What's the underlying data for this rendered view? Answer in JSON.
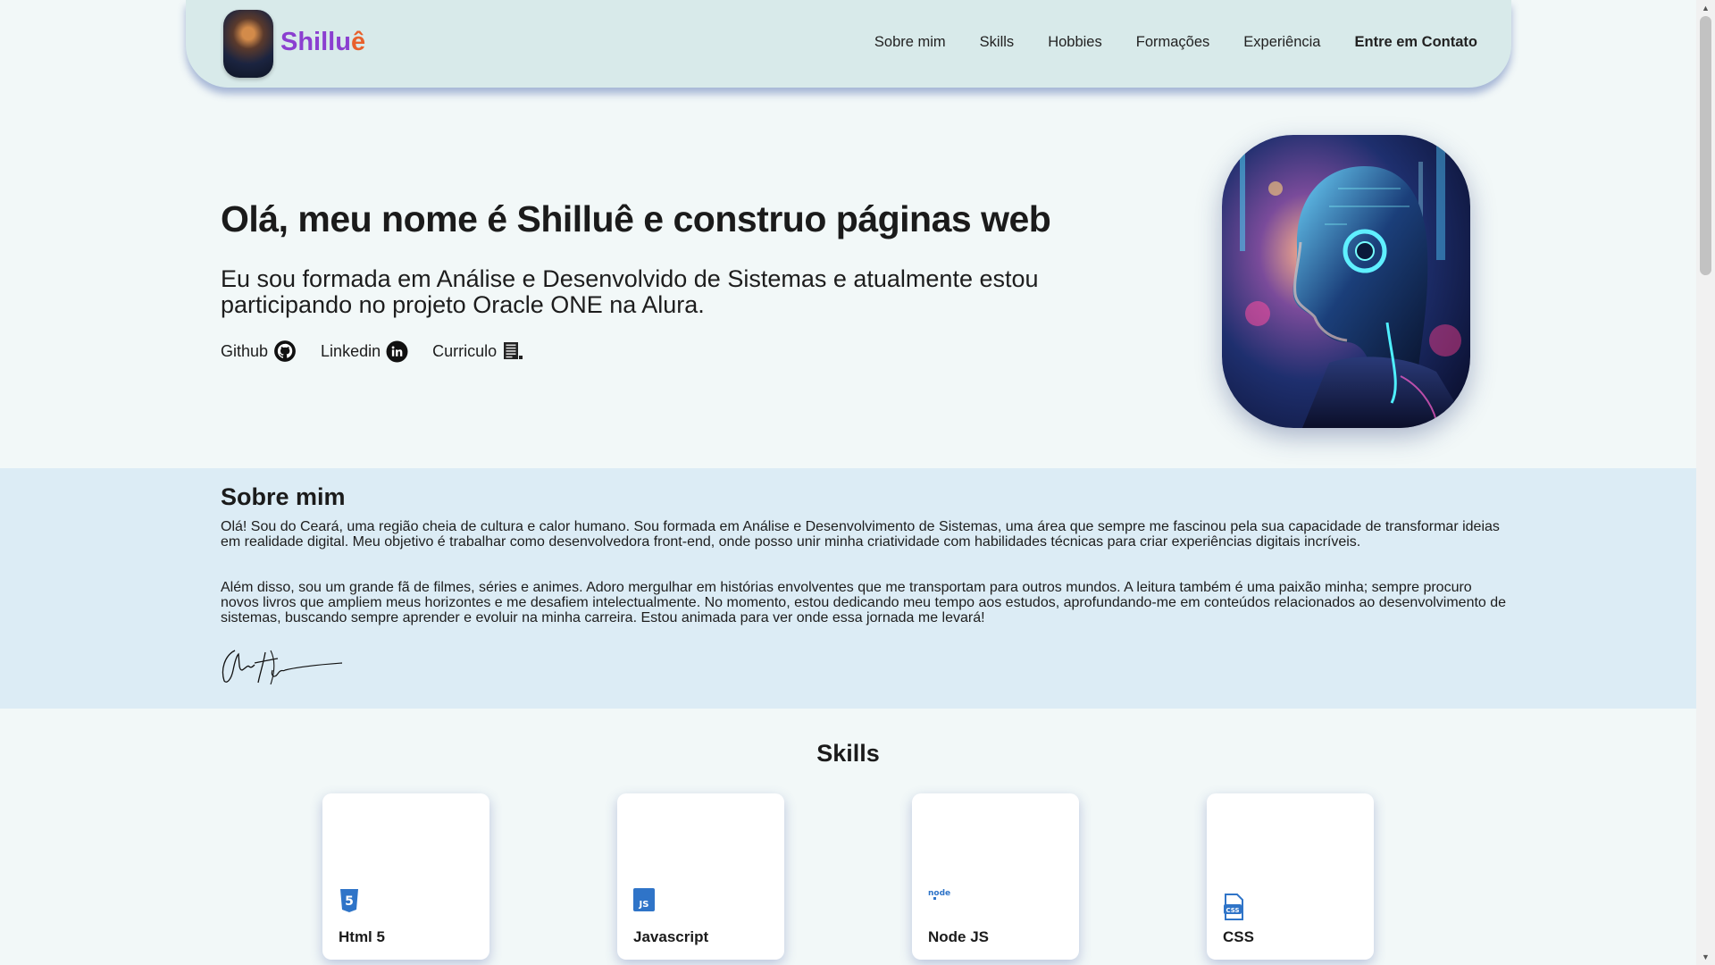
{
  "header": {
    "logo_text_main": "Shillu",
    "logo_text_accent": "ê",
    "nav": [
      {
        "label": "Sobre mim"
      },
      {
        "label": "Skills"
      },
      {
        "label": "Hobbies"
      },
      {
        "label": "Formações"
      },
      {
        "label": "Experiência"
      },
      {
        "label": "Entre em Contato"
      }
    ]
  },
  "hero": {
    "title": "Olá, meu nome é Shilluê e construo páginas web",
    "subtitle": "Eu sou formada em Análise e Desenvolvido de Sistemas e atualmente estou participando no projeto Oracle ONE na Alura.",
    "links": [
      {
        "label": "Github",
        "icon": "github-icon"
      },
      {
        "label": "Linkedin",
        "icon": "linkedin-icon"
      },
      {
        "label": "Curriculo",
        "icon": "document-icon"
      }
    ]
  },
  "about": {
    "title": "Sobre mim",
    "p1": "Olá! Sou do Ceará, uma região cheia de cultura e calor humano. Sou formada em Análise e Desenvolvimento de Sistemas, uma área que sempre me fascinou pela sua capacidade de transformar ideias em realidade digital. Meu objetivo é trabalhar como desenvolvedora front-end, onde posso unir minha criatividade com habilidades técnicas para criar experiências digitais incríveis.",
    "p2": "Além disso, sou um grande fã de filmes, séries e animes. Adoro mergulhar em histórias envolventes que me transportam para outros mundos. A leitura também é uma paixão minha; sempre procuro novos livros que ampliem meus horizontes e me desafiem intelectualmente. No momento, estou dedicando meu tempo aos estudos, aprofundando-me em conteúdos relacionados ao desenvolvimento de sistemas, buscando sempre aprender e evoluir na minha carreira. Estou animada para ver onde essa jornada me levará!"
  },
  "skills": {
    "title": "Skills",
    "items": [
      {
        "label": "Html 5",
        "icon": "html5-icon",
        "badge": "5"
      },
      {
        "label": "Javascript",
        "icon": "javascript-icon",
        "badge": "JS"
      },
      {
        "label": "Node JS",
        "icon": "nodejs-icon",
        "badge": "node"
      },
      {
        "label": "CSS",
        "icon": "css-icon",
        "badge": "CSS"
      }
    ]
  },
  "colors": {
    "header_bg": "#d8eaea",
    "page_bg": "#f2f8f8",
    "about_bg": "#dcecf5",
    "logo_purple": "#8b3fd0",
    "logo_orange": "#e8612c",
    "icon_blue": "#2f74c8"
  }
}
